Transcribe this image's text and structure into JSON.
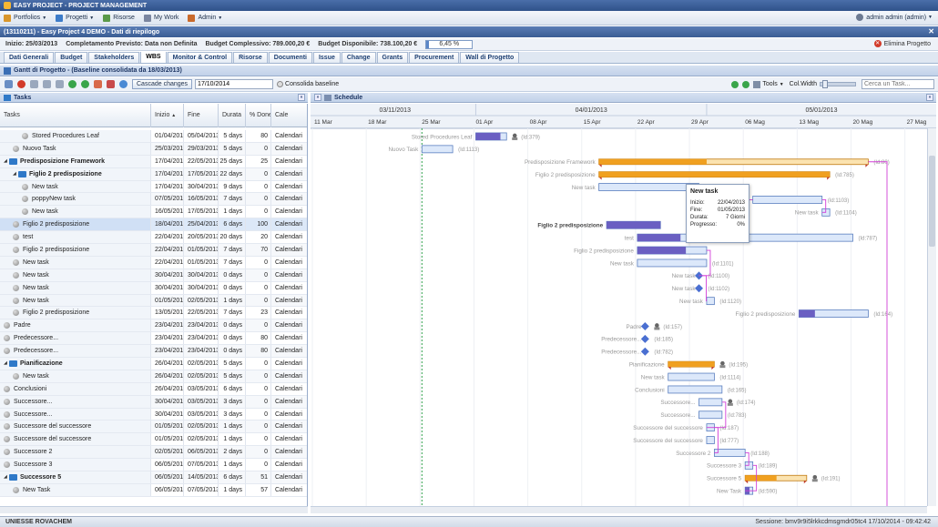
{
  "titlebar": {
    "title": "EASY PROJECT - PROJECT MANAGEMENT"
  },
  "menu": {
    "items": [
      {
        "label": "Portfolios",
        "has_caret": true,
        "color": "#d9962b"
      },
      {
        "label": "Progetti",
        "has_caret": true,
        "color": "#3d7cc9"
      },
      {
        "label": "Risorse",
        "has_caret": false,
        "color": "#5b9a49"
      },
      {
        "label": "My Work",
        "has_caret": false,
        "color": "#7b86a0"
      },
      {
        "label": "Admin",
        "has_caret": true,
        "color": "#c96a2b"
      }
    ],
    "user": "admin admin (admin)"
  },
  "project_header": {
    "title": "(13110211) - Easy Project 4 DEMO - Dati di riepilogo"
  },
  "info": {
    "start": "Inizio: 25/03/2013",
    "expected_end": "Completamento Previsto: Data non Definita",
    "budget_total": "Budget Complessivo: 789.000,20 €",
    "budget_available": "Budget Disponibile: 738.100,20 €",
    "percent": "6,45 %",
    "percent_value": 6.45,
    "delete": "Elimina Progetto"
  },
  "tabs": [
    {
      "label": "Dati Generali",
      "active": false
    },
    {
      "label": "Budget",
      "active": false
    },
    {
      "label": "Stakeholders",
      "active": false
    },
    {
      "label": "WBS",
      "active": true
    },
    {
      "label": "Monitor & Control",
      "active": false
    },
    {
      "label": "Risorse",
      "active": false
    },
    {
      "label": "Documenti",
      "active": false
    },
    {
      "label": "Issue",
      "active": false
    },
    {
      "label": "Change",
      "active": false
    },
    {
      "label": "Grants",
      "active": false
    },
    {
      "label": "Procurement",
      "active": false
    },
    {
      "label": "Wall di Progetto",
      "active": false
    }
  ],
  "gantt": {
    "title": "Gantt di Progetto - (Baseline consolidata da 18/03/2013)"
  },
  "toolbar": {
    "cascade": "Cascade changes",
    "date": "17/10/2014",
    "consolida": "Consolida baseline",
    "tools": "Tools",
    "colwidth": "Col.Width",
    "search_placeholder": "Cerca un Task..."
  },
  "tasks_panel": {
    "title": "Tasks",
    "columns": [
      "Tasks",
      "Inizio",
      "Fine",
      "Durata",
      "% Done",
      "Cale"
    ],
    "rows": [
      {
        "name": "Stored Procedures Leaf",
        "indent": 2,
        "kind": "task",
        "start": "01/04/2013",
        "end": "05/04/2013",
        "dur": "5 days",
        "pct": "80",
        "cal": "Calendari"
      },
      {
        "name": "Nuovo Task",
        "indent": 1,
        "kind": "task",
        "start": "25/03/2013",
        "end": "29/03/2013",
        "dur": "5 days",
        "pct": "0",
        "cal": "Calendari"
      },
      {
        "name": "Predisposizione Framework",
        "indent": 0,
        "kind": "folder",
        "start": "17/04/2013",
        "end": "22/05/2013",
        "dur": "25 days",
        "pct": "25",
        "cal": "Calendari"
      },
      {
        "name": "Figlio 2 predisposizione",
        "indent": 1,
        "kind": "folder",
        "start": "17/04/2013",
        "end": "17/05/2013",
        "dur": "22 days",
        "pct": "0",
        "cal": "Calendari"
      },
      {
        "name": "New task",
        "indent": 2,
        "kind": "task",
        "start": "17/04/2013",
        "end": "30/04/2013",
        "dur": "9 days",
        "pct": "0",
        "cal": "Calendari"
      },
      {
        "name": "poppyNew task",
        "indent": 2,
        "kind": "task",
        "start": "07/05/2013",
        "end": "16/05/2013",
        "dur": "7 days",
        "pct": "0",
        "cal": "Calendari"
      },
      {
        "name": "New task",
        "indent": 2,
        "kind": "task",
        "start": "16/05/2013",
        "end": "17/05/2013",
        "dur": "1 days",
        "pct": "0",
        "cal": "Calendari"
      },
      {
        "name": "Figlio 2 predisposizione",
        "indent": 1,
        "kind": "task",
        "start": "18/04/2013",
        "end": "25/04/2013",
        "dur": "6 days",
        "pct": "100",
        "cal": "Calendari",
        "selected": true
      },
      {
        "name": "test",
        "indent": 1,
        "kind": "task",
        "start": "22/04/2013",
        "end": "20/05/2013",
        "dur": "20 days",
        "pct": "20",
        "cal": "Calendari"
      },
      {
        "name": "Figlio 2 predisposizione",
        "indent": 1,
        "kind": "task",
        "start": "22/04/2013",
        "end": "01/05/2013",
        "dur": "7 days",
        "pct": "70",
        "cal": "Calendari"
      },
      {
        "name": "New task",
        "indent": 1,
        "kind": "task",
        "start": "22/04/2013",
        "end": "01/05/2013",
        "dur": "7 days",
        "pct": "0",
        "cal": "Calendari"
      },
      {
        "name": "New task",
        "indent": 1,
        "kind": "task",
        "start": "30/04/2013",
        "end": "30/04/2013",
        "dur": "0 days",
        "pct": "0",
        "cal": "Calendari"
      },
      {
        "name": "New task",
        "indent": 1,
        "kind": "task",
        "start": "30/04/2013",
        "end": "30/04/2013",
        "dur": "0 days",
        "pct": "0",
        "cal": "Calendari"
      },
      {
        "name": "New task",
        "indent": 1,
        "kind": "task",
        "start": "01/05/2013",
        "end": "02/05/2013",
        "dur": "1 days",
        "pct": "0",
        "cal": "Calendari"
      },
      {
        "name": "Figlio 2 predisposizione",
        "indent": 1,
        "kind": "task",
        "start": "13/05/2013",
        "end": "22/05/2013",
        "dur": "7 days",
        "pct": "23",
        "cal": "Calendari"
      },
      {
        "name": "Padre",
        "indent": 0,
        "kind": "task",
        "start": "23/04/2013",
        "end": "23/04/2013",
        "dur": "0 days",
        "pct": "0",
        "cal": "Calendari"
      },
      {
        "name": "Predecessore...",
        "indent": 0,
        "kind": "task",
        "start": "23/04/2013",
        "end": "23/04/2013",
        "dur": "0 days",
        "pct": "80",
        "cal": "Calendari"
      },
      {
        "name": "Predecessore...",
        "indent": 0,
        "kind": "task",
        "start": "23/04/2013",
        "end": "23/04/2013",
        "dur": "0 days",
        "pct": "80",
        "cal": "Calendari"
      },
      {
        "name": "Pianificazione",
        "indent": 0,
        "kind": "folder",
        "start": "26/04/2013",
        "end": "02/05/2013",
        "dur": "5 days",
        "pct": "0",
        "cal": "Calendari"
      },
      {
        "name": "New task",
        "indent": 1,
        "kind": "task",
        "start": "26/04/2013",
        "end": "02/05/2013",
        "dur": "5 days",
        "pct": "0",
        "cal": "Calendari"
      },
      {
        "name": "Conclusioni",
        "indent": 0,
        "kind": "task",
        "start": "26/04/2013",
        "end": "03/05/2013",
        "dur": "6 days",
        "pct": "0",
        "cal": "Calendari"
      },
      {
        "name": "Successore...",
        "indent": 0,
        "kind": "task",
        "start": "30/04/2013",
        "end": "03/05/2013",
        "dur": "3 days",
        "pct": "0",
        "cal": "Calendari"
      },
      {
        "name": "Successore...",
        "indent": 0,
        "kind": "task",
        "start": "30/04/2013",
        "end": "03/05/2013",
        "dur": "3 days",
        "pct": "0",
        "cal": "Calendari"
      },
      {
        "name": "Successore del successore",
        "indent": 0,
        "kind": "task",
        "start": "01/05/2013",
        "end": "02/05/2013",
        "dur": "1 days",
        "pct": "0",
        "cal": "Calendari"
      },
      {
        "name": "Successore del successore",
        "indent": 0,
        "kind": "task",
        "start": "01/05/2013",
        "end": "02/05/2013",
        "dur": "1 days",
        "pct": "0",
        "cal": "Calendari"
      },
      {
        "name": "Successore 2",
        "indent": 0,
        "kind": "task",
        "start": "02/05/2013",
        "end": "06/05/2013",
        "dur": "2 days",
        "pct": "0",
        "cal": "Calendari"
      },
      {
        "name": "Successore 3",
        "indent": 0,
        "kind": "task",
        "start": "06/05/2013",
        "end": "07/05/2013",
        "dur": "1 days",
        "pct": "0",
        "cal": "Calendari"
      },
      {
        "name": "Successore 5",
        "indent": 0,
        "kind": "folder",
        "start": "06/05/2013",
        "end": "14/05/2013",
        "dur": "6 days",
        "pct": "51",
        "cal": "Calendari"
      },
      {
        "name": "New Task",
        "indent": 1,
        "kind": "task",
        "start": "06/05/2013",
        "end": "07/05/2013",
        "dur": "1 days",
        "pct": "57",
        "cal": "Calendari"
      }
    ]
  },
  "schedule": {
    "title": "Schedule",
    "months": [
      "03/11/2013",
      "04/01/2013",
      "05/01/2013"
    ],
    "weeks": [
      "11 Mar",
      "18 Mar",
      "25 Mar",
      "01 Apr",
      "08 Apr",
      "15 Apr",
      "22 Apr",
      "29 Apr",
      "06 Mag",
      "13 Mag",
      "20 Mag",
      "27 Mag"
    ],
    "bars": [
      {
        "label": "Stored Procedures Leaf",
        "kind": "task",
        "start": "01/04/2013",
        "end": "05/04/2013",
        "progress": 80,
        "id": "(Id:379)",
        "assignee": true
      },
      {
        "label": "Nuovo Task",
        "kind": "task",
        "start": "25/03/2013",
        "end": "29/03/2013",
        "progress": 0,
        "id": "(Id:1113)"
      },
      {
        "label": "Predisposizione Framework",
        "kind": "summary",
        "start": "17/04/2013",
        "end": "22/05/2013",
        "progress": 25,
        "id": "(Id:80)"
      },
      {
        "label": "Figlio 2 predisposizione",
        "kind": "summary",
        "start": "17/04/2013",
        "end": "17/05/2013",
        "progress": 0,
        "id": "(Id:785)"
      },
      {
        "label": "New task",
        "kind": "task",
        "start": "17/04/2013",
        "end": "30/04/2013",
        "progress": 0,
        "id": ""
      },
      {
        "label": "",
        "kind": "task",
        "start": "07/05/2013",
        "end": "16/05/2013",
        "progress": 0,
        "id": "(Id:1103)"
      },
      {
        "label": "New task",
        "kind": "task",
        "start": "16/05/2013",
        "end": "17/05/2013",
        "progress": 0,
        "id": "(Id:1104)"
      },
      {
        "label": "Figlio 2 predisposizione",
        "kind": "task",
        "start": "18/04/2013",
        "end": "25/04/2013",
        "progress": 100,
        "id": "",
        "bold": true
      },
      {
        "label": "test",
        "kind": "task",
        "start": "22/04/2013",
        "end": "20/05/2013",
        "progress": 20,
        "id": "(Id:787)"
      },
      {
        "label": "Figlio 2 predisposizione",
        "kind": "task",
        "start": "22/04/2013",
        "end": "01/05/2013",
        "progress": 70,
        "id": ""
      },
      {
        "label": "New task",
        "kind": "task",
        "start": "22/04/2013",
        "end": "01/05/2013",
        "progress": 0,
        "id": "(Id:1101)"
      },
      {
        "label": "New task",
        "kind": "milestone",
        "start": "30/04/2013",
        "end": "30/04/2013",
        "progress": 0,
        "id": "(Id:1100)"
      },
      {
        "label": "New task",
        "kind": "milestone",
        "start": "30/04/2013",
        "end": "30/04/2013",
        "progress": 0,
        "id": "(Id:1102)"
      },
      {
        "label": "New task",
        "kind": "task",
        "start": "01/05/2013",
        "end": "02/05/2013",
        "progress": 0,
        "id": "(Id:1120)"
      },
      {
        "label": "Figlio 2 predisposizione",
        "kind": "task",
        "start": "13/05/2013",
        "end": "22/05/2013",
        "progress": 23,
        "id": "(Id:164)"
      },
      {
        "label": "Padre",
        "kind": "milestone",
        "start": "23/04/2013",
        "end": "23/04/2013",
        "progress": 0,
        "id": "(Id:157)",
        "assignee": true
      },
      {
        "label": "Predecessore...",
        "kind": "milestone",
        "start": "23/04/2013",
        "end": "23/04/2013",
        "progress": 80,
        "id": "(Id:185)"
      },
      {
        "label": "Predecessore...",
        "kind": "milestone",
        "start": "23/04/2013",
        "end": "23/04/2013",
        "progress": 80,
        "id": "(Id:782)"
      },
      {
        "label": "Pianificazione",
        "kind": "summary",
        "start": "26/04/2013",
        "end": "02/05/2013",
        "progress": 0,
        "id": "(Id:195)",
        "assignee": true
      },
      {
        "label": "New task",
        "kind": "task",
        "start": "26/04/2013",
        "end": "02/05/2013",
        "progress": 0,
        "id": "(Id:1114)"
      },
      {
        "label": "Conclusioni",
        "kind": "task",
        "start": "26/04/2013",
        "end": "03/05/2013",
        "progress": 0,
        "id": "(Id:165)"
      },
      {
        "label": "Successore...",
        "kind": "task",
        "start": "30/04/2013",
        "end": "03/05/2013",
        "progress": 0,
        "id": "(Id:174)",
        "assignee": true
      },
      {
        "label": "Successore...",
        "kind": "task",
        "start": "30/04/2013",
        "end": "03/05/2013",
        "progress": 0,
        "id": "(Id:783)"
      },
      {
        "label": "Successore del successore",
        "kind": "task",
        "start": "01/05/2013",
        "end": "02/05/2013",
        "progress": 0,
        "id": "(Id:187)"
      },
      {
        "label": "Successore del successore",
        "kind": "task",
        "start": "01/05/2013",
        "end": "02/05/2013",
        "progress": 0,
        "id": "(Id:777)"
      },
      {
        "label": "Successore 2",
        "kind": "task",
        "start": "02/05/2013",
        "end": "06/05/2013",
        "progress": 0,
        "id": "(Id:188)"
      },
      {
        "label": "Successore 3",
        "kind": "task",
        "start": "06/05/2013",
        "end": "07/05/2013",
        "progress": 0,
        "id": "(Id:189)"
      },
      {
        "label": "Successore 5",
        "kind": "summary",
        "start": "06/05/2013",
        "end": "14/05/2013",
        "progress": 51,
        "id": "(Id:191)",
        "assignee": true
      },
      {
        "label": "New Task",
        "kind": "task",
        "start": "06/05/2013",
        "end": "07/05/2013",
        "progress": 57,
        "id": "(Id:590)"
      }
    ],
    "today": "25/03/2013"
  },
  "tooltip": {
    "title": "New task",
    "inizio_label": "Inizio:",
    "inizio": "22/04/2013",
    "fine_label": "Fine:",
    "fine": "01/05/2013",
    "durata_label": "Durata:",
    "durata": "7 Giorni",
    "progresso_label": "Progresso:",
    "progresso": "0%"
  },
  "status": {
    "left": "UNIESSE ROVACHEM",
    "right": "Sessione: bmv9r9i5lrkkcdmsgmdr05tc4   17/10/2014 - 09:42:42"
  },
  "colors": {
    "summary_bar": "#f0a020",
    "task_bar": "#dce8fa",
    "task_border": "#5a7fbf",
    "progress_fill": "#6a5fc2",
    "milestone": "#4a6fd1",
    "link": "#d23ed7",
    "today_line": "#2ea04a"
  }
}
